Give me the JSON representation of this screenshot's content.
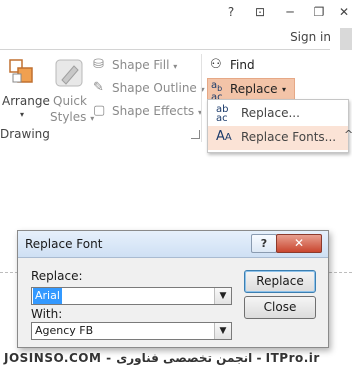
{
  "titlebar": {
    "help_label": "?",
    "restore_ribbon_label": "⊡",
    "minimize_label": "─",
    "restore_label": "❐",
    "close_label": "✕"
  },
  "account": {
    "sign_in": "Sign in"
  },
  "ribbon": {
    "arrange_label": "Arrange",
    "quick_styles_line1": "Quick",
    "quick_styles_line2": "Styles",
    "shape_fill": "Shape Fill",
    "shape_outline": "Shape Outline",
    "shape_effects": "Shape Effects",
    "group_drawing": "Drawing",
    "find_label": "Find",
    "replace_label": "Replace",
    "chevron": "▾",
    "dropdown_arrow": "▾",
    "more_label": "^"
  },
  "replace_menu": {
    "items": [
      {
        "label": "Replace..."
      },
      {
        "label": "Replace Fonts..."
      }
    ],
    "highlighted_index": 1
  },
  "dialog": {
    "title": "Replace Font",
    "help": "?",
    "close": "✕",
    "replace_field_label": "Replace:",
    "replace_value": "Arial",
    "with_field_label": "With:",
    "with_value": "Agency FB",
    "replace_button": "Replace",
    "close_button": "Close"
  },
  "watermark": "JOSINSO.COM - انجمن تخصصی فناوری - ITPro.ir",
  "colors": {
    "accent_orange": "#f3c4a8",
    "menu_highlight": "#fbe3d6",
    "selection_blue": "#3399ff",
    "close_red": "#c9462f"
  }
}
